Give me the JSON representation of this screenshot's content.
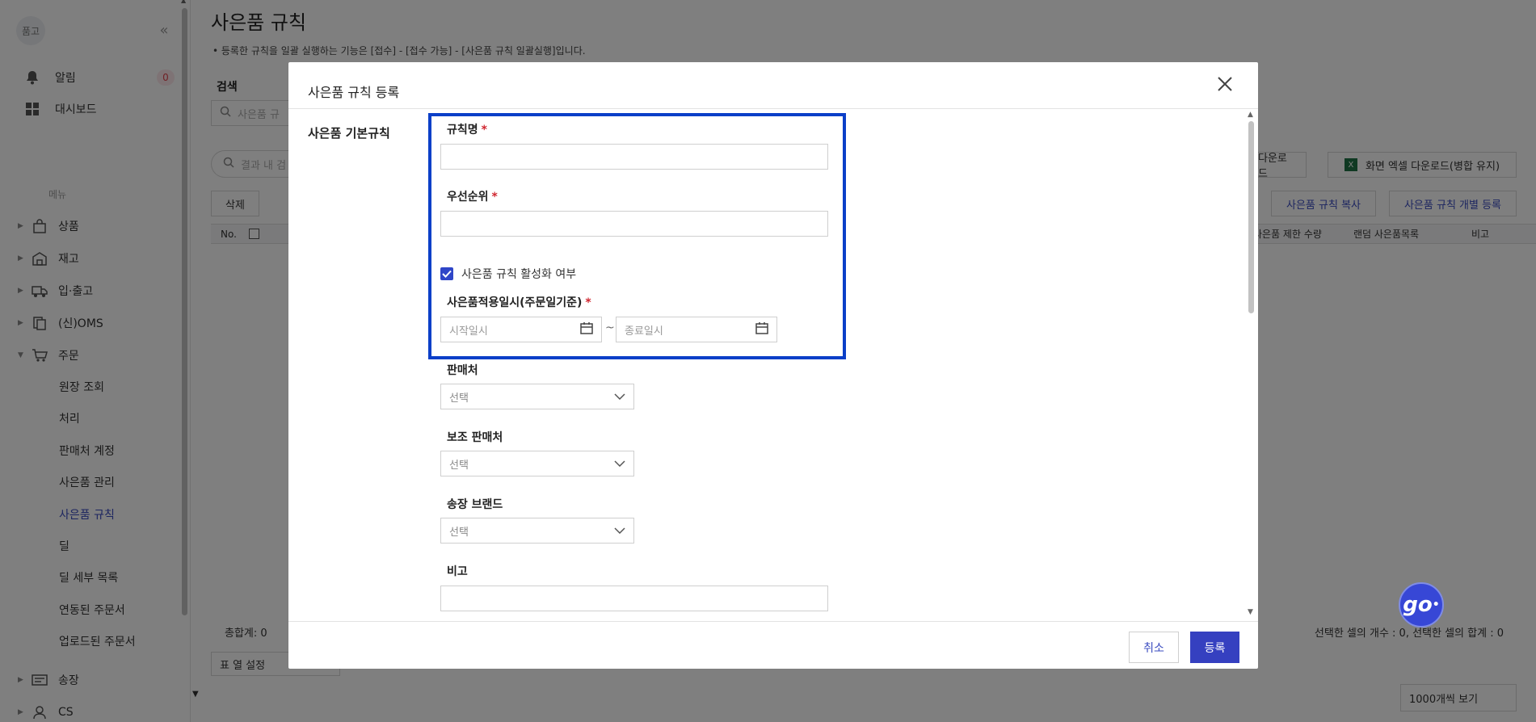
{
  "sidebar": {
    "avatar_text": "품고",
    "collapse_icon": "double-chevron-left-icon",
    "notifications_label": "알림",
    "notifications_count": "0",
    "dashboard_label": "대시보드",
    "menu_caption": "메뉴",
    "nav": [
      {
        "label": "상품",
        "icon": "bag-icon"
      },
      {
        "label": "재고",
        "icon": "warehouse-icon"
      },
      {
        "label": "입·출고",
        "icon": "truck-icon"
      },
      {
        "label": "(신)OMS",
        "icon": "document-icon"
      },
      {
        "label": "주문",
        "icon": "cart-icon"
      }
    ],
    "order_sub": [
      "원장 조회",
      "처리",
      "판매처 계정",
      "사은품 관리",
      "사은품 규칙",
      "딜",
      "딜 세부 목록",
      "연동된 주문서",
      "업로드된 주문서"
    ],
    "active_sub": "사은품 규칙",
    "nav_bottom": [
      {
        "label": "송장",
        "icon": "invoice-icon"
      },
      {
        "label": "CS",
        "icon": "user-icon"
      }
    ]
  },
  "main": {
    "title": "사은품 규칙",
    "note": "• 등록한 규칙을 일괄 실행하는 기능은 [접수] - [접수 가능] - [사은품 규칙 일괄실행]입니다.",
    "search_label": "검색",
    "search_placeholder": "사은품 규",
    "filter_placeholder": "결과 내 검",
    "delete_label": "삭제",
    "excel_download_label": "다운로드",
    "excel_screen_label": "화면 엑셀 다운로드(병합 유지)",
    "copy_rule_label": "사은품 규칙 복사",
    "individual_register_label": "사은품 규칙 개별 등록",
    "table_headers": {
      "no": "No.",
      "limit_qty": "사은품 제한 수량",
      "random_list": "랜덤 사은품목록",
      "remark": "비고"
    },
    "total": "총합계: 0",
    "selection_info": "선택한 셀의 개수 : 0, 선택한 셀의 합계 : 0",
    "column_setting": "표 열 설정",
    "page_size": "1000개씩 보기"
  },
  "modal": {
    "title": "사은품 규칙 등록",
    "section_label": "사은품 기본규칙",
    "rule_name_label": "규칙명",
    "rule_name_value": "",
    "priority_label": "우선순위",
    "priority_value": "",
    "active_label": "사은품 규칙 활성화 여부",
    "active_checked": true,
    "apply_period_label": "사은품적용일시(주문일기준)",
    "start_placeholder": "시작일시",
    "end_placeholder": "종료일시",
    "date_separator": "~",
    "seller_label": "판매처",
    "seller_value": "선택",
    "sub_seller_label": "보조 판매처",
    "sub_seller_value": "선택",
    "invoice_brand_label": "송장 브랜드",
    "invoice_brand_value": "선택",
    "remark_label": "비고",
    "remark_value": "",
    "required_mark": "*",
    "cancel_label": "취소",
    "submit_label": "등록"
  },
  "floating": {
    "badge_text": "go",
    "badge_dot": "•"
  },
  "colors": {
    "accent": "#3540c0",
    "highlight": "#0b3fc8",
    "required": "#d0262f",
    "badge_bg": "#fde7ea",
    "badge_fg": "#e0424c"
  }
}
